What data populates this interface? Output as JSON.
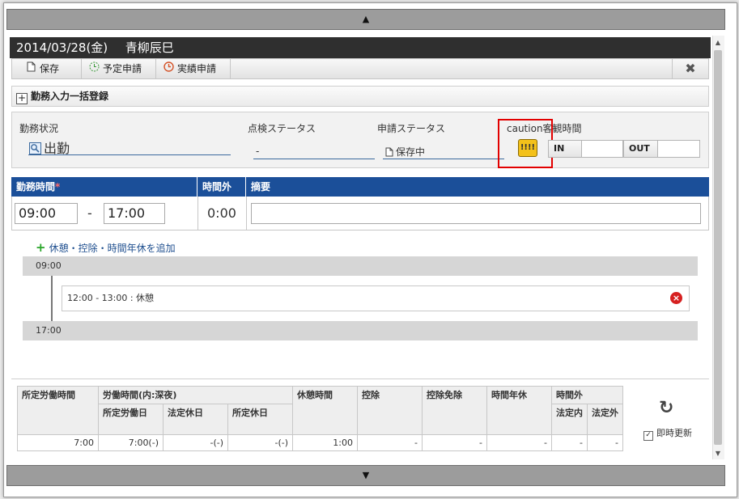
{
  "nav": {
    "up_arrow": "▲",
    "down_arrow": "▼"
  },
  "header": {
    "date": "2014/03/28(金)",
    "name": "青柳辰巳"
  },
  "toolbar": {
    "save_label": "保存",
    "plan_label": "予定申請",
    "actual_label": "実績申請",
    "close_icon": "✖"
  },
  "bulk_entry": {
    "label": "勤務入力一括登録",
    "icon": "+"
  },
  "status": {
    "work_status_label": "勤務状況",
    "work_status_value": "出勤",
    "check_status_label": "点検ステータス",
    "check_status_value": "-",
    "apply_status_label": "申請ステータス",
    "apply_status_value": "保存中",
    "caution_text": "caution",
    "gate_time_label": "客観時間",
    "in_label": "IN",
    "out_label": "OUT",
    "in_value": "",
    "out_value": ""
  },
  "work_time": {
    "col_work_time": "勤務時間",
    "required_mark": "*",
    "col_overtime": "時間外",
    "col_note": "摘要",
    "start": "09:00",
    "separator": "-",
    "end": "17:00",
    "overtime": "0:00",
    "note": ""
  },
  "breaks": {
    "add_label": "休憩・控除・時間年休を追加",
    "start_marker": "09:00",
    "end_marker": "17:00",
    "items": [
      {
        "label": "12:00 - 13:00 : 休憩"
      }
    ]
  },
  "summary": {
    "headers": {
      "scheduled_work": "所定労働時間",
      "labor_time": "労働時間(内:深夜)",
      "scheduled_workday": "所定労働日",
      "legal_holiday": "法定休日",
      "scheduled_holiday": "所定休日",
      "break_time": "休憩時間",
      "deduction": "控除",
      "deduction_exempt": "控除免除",
      "hourly_leave": "時間年休",
      "overtime": "時間外",
      "legal_in": "法定内",
      "legal_out": "法定外"
    },
    "values": {
      "scheduled_work": "7:00",
      "scheduled_workday": "7:00(-)",
      "legal_holiday": "-(-)",
      "scheduled_holiday": "-(-)",
      "break_time": "1:00",
      "deduction": "-",
      "deduction_exempt": "-",
      "hourly_leave": "-",
      "legal_in": "-",
      "legal_out": "-"
    },
    "refresh_icon": "↻",
    "auto_refresh_label": "即時更新",
    "auto_refresh_checked": "✓"
  }
}
